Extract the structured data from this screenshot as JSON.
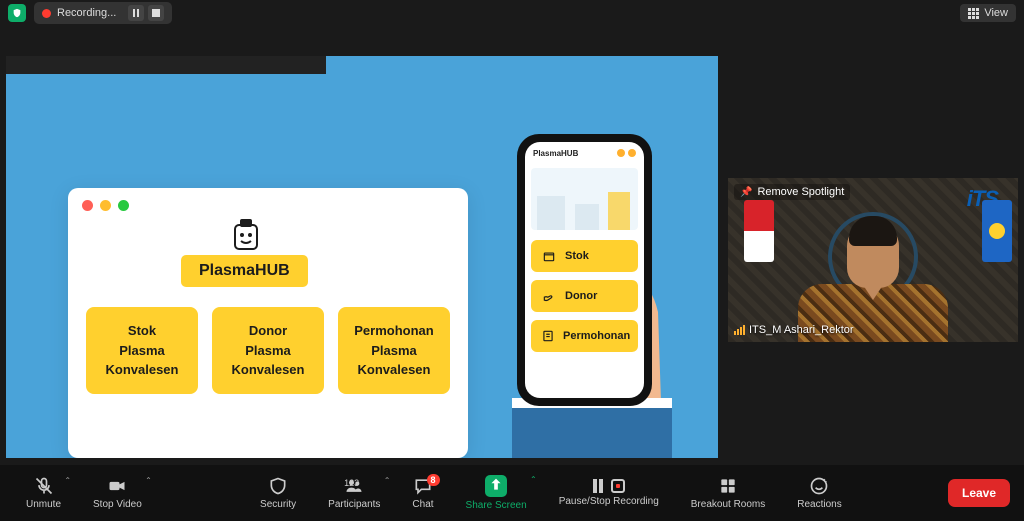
{
  "topbar": {
    "recording_label": "Recording...",
    "view_label": "View"
  },
  "spotlight": {
    "remove_label": "Remove Spotlight",
    "participant_name": "ITS_M Ashari_Rektor",
    "logo_text": "iTS"
  },
  "presentation": {
    "app_title": "PlasmaHUB",
    "web_cards": [
      {
        "line1": "Stok",
        "line2": "Plasma",
        "line3": "Konvalesen"
      },
      {
        "line1": "Donor",
        "line2": "Plasma",
        "line3": "Konvalesen"
      },
      {
        "line1": "Permohonan",
        "line2": "Plasma",
        "line3": "Konvalesen"
      }
    ],
    "phone_cards": [
      {
        "label": "Stok"
      },
      {
        "label": "Donor"
      },
      {
        "label": "Permohonan"
      }
    ]
  },
  "toolbar": {
    "unmute": "Unmute",
    "stop_video": "Stop Video",
    "security": "Security",
    "participants": "Participants",
    "participants_count": "123",
    "chat": "Chat",
    "chat_badge": "8",
    "share_screen": "Share Screen",
    "pause_stop": "Pause/Stop Recording",
    "breakout": "Breakout Rooms",
    "reactions": "Reactions",
    "leave": "Leave"
  }
}
